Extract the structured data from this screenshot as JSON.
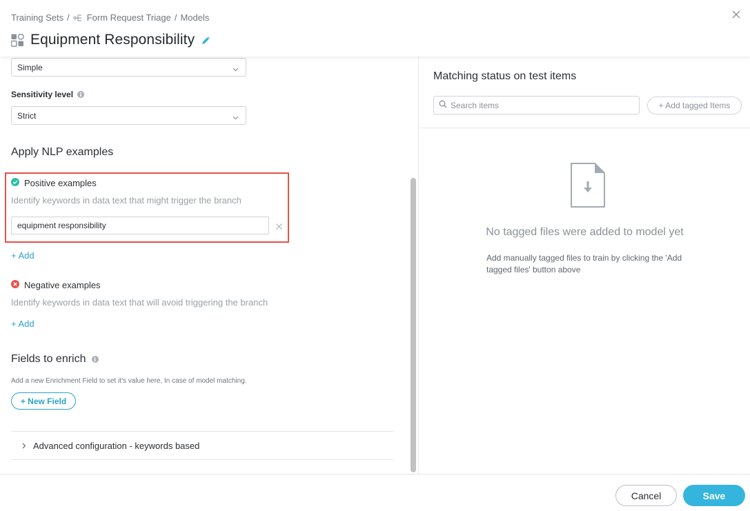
{
  "header": {
    "breadcrumb": [
      "Training Sets",
      "Form Request Triage",
      "Models"
    ],
    "breadcrumb_separator": "/",
    "title": "Equipment Responsibility",
    "icons": {
      "title": "model-grid-icon",
      "edit": "pencil-icon",
      "close": "close-icon",
      "crumb": "branch-icon"
    }
  },
  "form": {
    "mode_select": {
      "value": "Simple"
    },
    "sensitivity": {
      "label": "Sensitivity level",
      "value": "Strict"
    },
    "nlp_section_title": "Apply NLP examples",
    "positive": {
      "title": "Positive examples",
      "description": "Identify keywords in data text that might trigger the branch",
      "input_value": "equipment responsibility",
      "add_label": "+ Add"
    },
    "negative": {
      "title": "Negative examples",
      "description": "Identify keywords in data text that will avoid triggering the branch",
      "add_label": "+ Add"
    },
    "enrich": {
      "title": "Fields to enrich",
      "note": "Add a new Enrichment Field to set it's value here, In case of model matching.",
      "button": "+ New Field"
    },
    "advanced": {
      "label": "Advanced configuration - keywords based"
    }
  },
  "right_panel": {
    "title": "Matching status on test items",
    "search_placeholder": "Search items",
    "add_tagged_button": "+ Add tagged Items",
    "empty_title": "No tagged files were added to model yet",
    "empty_description": "Add manually tagged files to train by clicking the 'Add tagged files' button above"
  },
  "footer": {
    "cancel": "Cancel",
    "save": "Save"
  },
  "colors": {
    "accent": "#35b5dd",
    "link": "#2aa3c8",
    "positive": "#2bbfa4",
    "negative": "#e5514a",
    "highlight": "#e5514a"
  }
}
